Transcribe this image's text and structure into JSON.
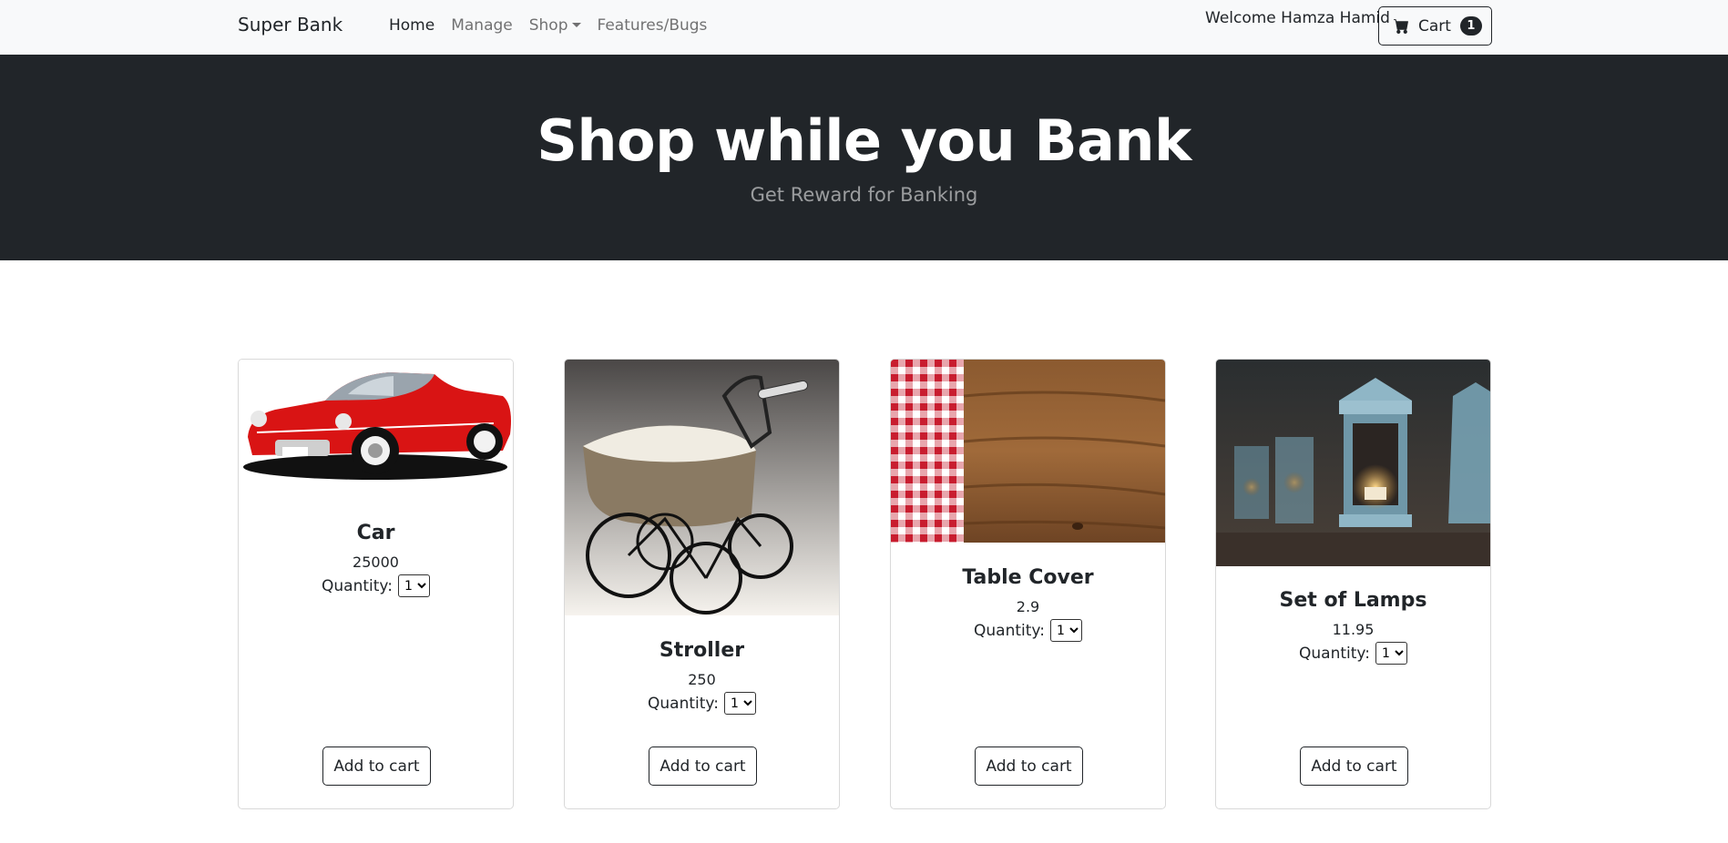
{
  "nav": {
    "brand": "Super Bank",
    "links": [
      "Home",
      "Manage",
      "Shop",
      "Features/Bugs"
    ],
    "welcome": "Welcome Hamza Hamid",
    "cart_label": "Cart",
    "cart_count": "1"
  },
  "hero": {
    "title": "Shop while you Bank",
    "subtitle": "Get Reward for Banking"
  },
  "products": [
    {
      "name": "Car",
      "price": "25000",
      "qty_label": "Quantity:",
      "qty_value": "1",
      "button": "Add to cart",
      "image": "red-convertible-car"
    },
    {
      "name": "Stroller",
      "price": "250",
      "qty_label": "Quantity:",
      "qty_value": "1",
      "button": "Add to cart",
      "image": "vintage-baby-stroller"
    },
    {
      "name": "Table Cover",
      "price": "2.9",
      "qty_label": "Quantity:",
      "qty_value": "1",
      "button": "Add to cart",
      "image": "checkered-cloth-on-wood"
    },
    {
      "name": "Set of Lamps",
      "price": "11.95",
      "qty_label": "Quantity:",
      "qty_value": "1",
      "button": "Add to cart",
      "image": "lanterns"
    }
  ],
  "colors": {
    "navbar_bg": "#f8f9fa",
    "hero_bg": "#212529",
    "text": "#212529"
  }
}
